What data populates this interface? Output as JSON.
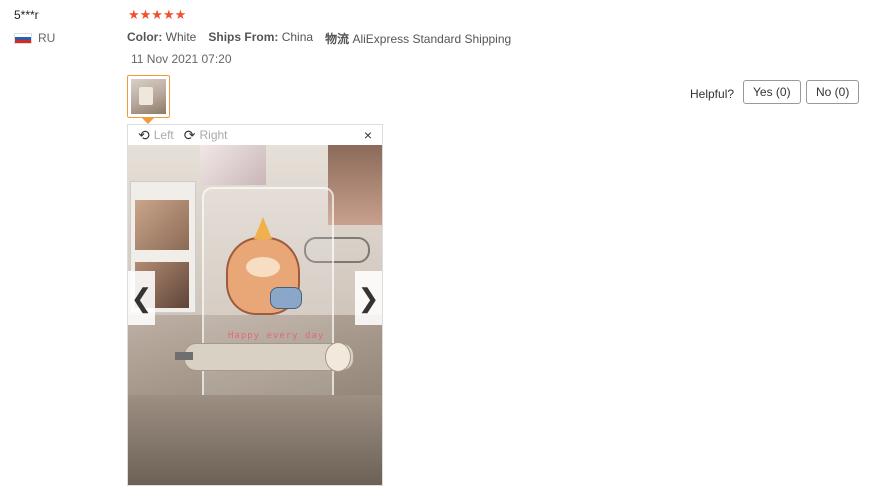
{
  "review": {
    "user": "5***r",
    "country": "RU",
    "stars": "★★★★★",
    "color_label": "Color:",
    "color_value": "White",
    "ships_label": "Ships From:",
    "ships_value": "China",
    "shipping_label": "物流",
    "shipping_value": "AliExpress Standard Shipping",
    "date": "11 Nov 2021 07:20"
  },
  "helpful": {
    "label": "Helpful?",
    "yes": "Yes (0)",
    "no": "No (0)"
  },
  "viewer": {
    "rotate_left": "Left",
    "rotate_right": "Right",
    "close": "×",
    "prev": "❮",
    "next": "❯",
    "photo_text": "Happy every day"
  },
  "icons": {
    "rotate_left_icon": "⟲",
    "rotate_right_icon": "⟳"
  },
  "colors": {
    "star": "#f0502c",
    "thumb_border": "#f39a3a"
  }
}
